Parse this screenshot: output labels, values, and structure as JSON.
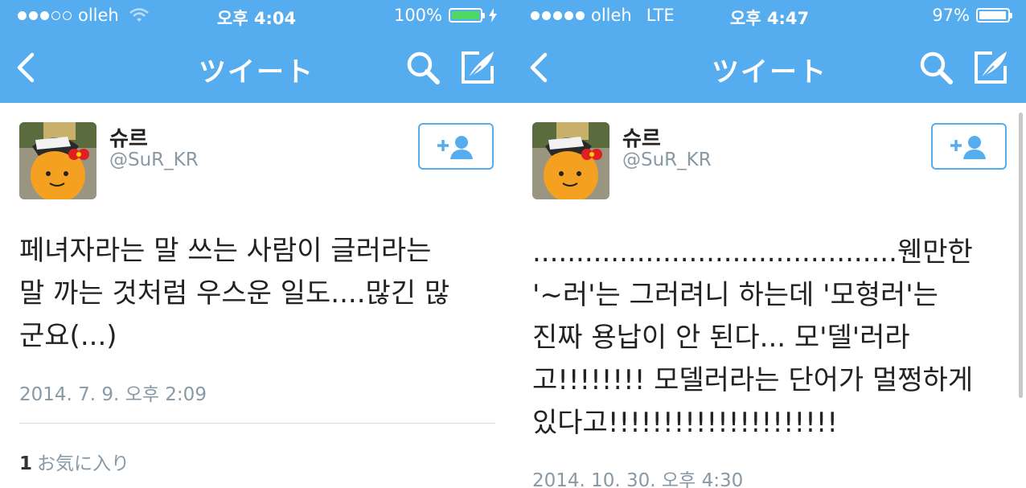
{
  "screens": [
    {
      "status": {
        "signal_bars_on": 3,
        "signal_bars_total": 5,
        "carrier": "olleh",
        "network": "",
        "time": "오후 4:04",
        "battery": "100%",
        "battery_level": 1.0,
        "battery_color": "#4cd964",
        "charging": true
      },
      "nav": {
        "title": "ツイート"
      },
      "user": {
        "name": "슈르",
        "handle": "@SuR_KR"
      },
      "tweet": {
        "lines": [
          "페녀자라는 말 쓰는 사람이 글러라는",
          "말 까는 것처럼 우스운 일도....많긴 많",
          "군요(...)"
        ]
      },
      "date": "2014. 7. 9. 오후 2:09",
      "favorites": {
        "count": "1",
        "label": "お気に入り"
      }
    },
    {
      "status": {
        "signal_bars_on": 5,
        "signal_bars_total": 5,
        "carrier": "olleh",
        "network": "LTE",
        "time": "오후 4:47",
        "battery": "97%",
        "battery_level": 0.97,
        "battery_color": "#ffffff",
        "charging": false
      },
      "nav": {
        "title": "ツイート"
      },
      "user": {
        "name": "슈르",
        "handle": "@SuR_KR"
      },
      "tweet": {
        "lines": [
          "..........................................웬만한",
          "'~러'는 그러려니 하는데 '모형러'는",
          "진짜 용납이 안 된다... 모'델'러라",
          "고!!!!!!!! 모델러라는 단어가 멀쩡하게",
          "있다고!!!!!!!!!!!!!!!!!!!!!"
        ]
      },
      "date": "2014. 10. 30. 오후 4:30"
    }
  ],
  "colors": {
    "header": "#55acee",
    "text": "#222222",
    "secondary": "#8899a6"
  },
  "icons": [
    "back-chevron-icon",
    "search-icon",
    "compose-icon",
    "add-user-icon"
  ]
}
